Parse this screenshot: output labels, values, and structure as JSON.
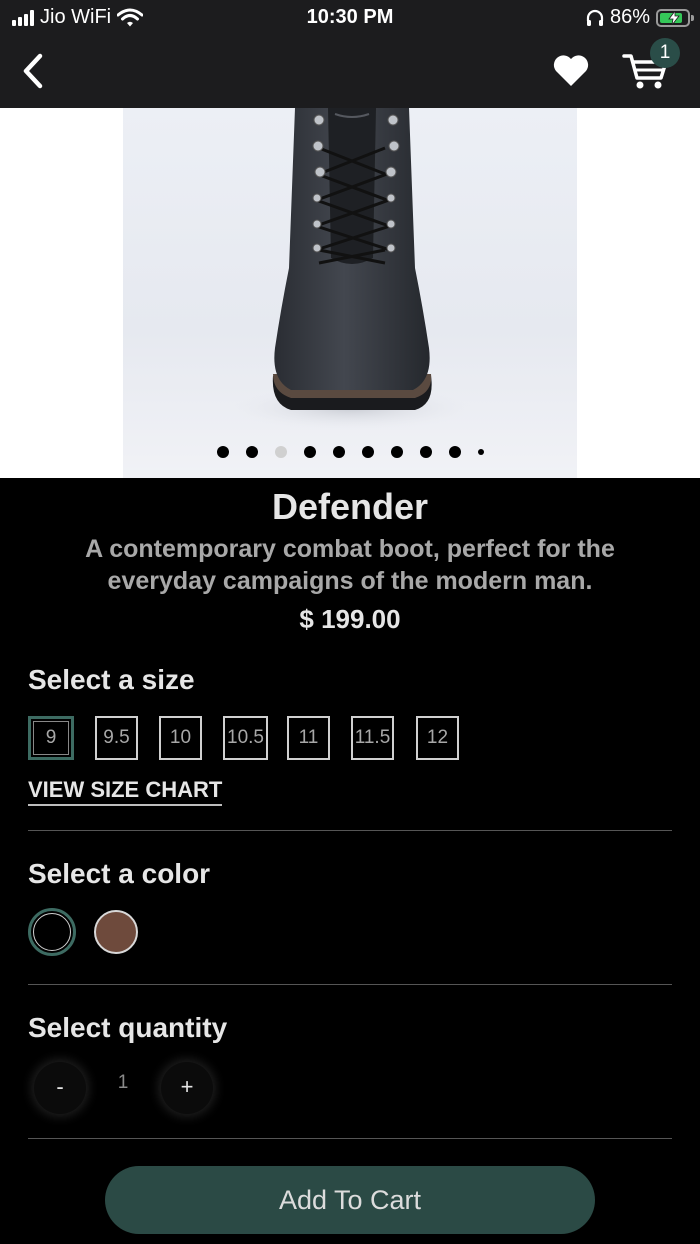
{
  "status_bar": {
    "carrier": "Jio WiFi",
    "time": "10:30 PM",
    "battery_percent": "86%",
    "battery_level": 0.86,
    "icons": [
      "signal-bars-icon",
      "wifi-icon",
      "headphones-icon",
      "battery-charging-icon"
    ]
  },
  "nav": {
    "icons": [
      "back-chevron-icon",
      "heart-icon",
      "cart-icon"
    ],
    "cart_count": "1"
  },
  "gallery": {
    "image_count": 10,
    "active_index": 2
  },
  "product": {
    "name": "Defender",
    "description_line1": "A contemporary combat boot, perfect for the",
    "description_line2": "everyday campaigns of the modern man.",
    "price": "$ 199.00"
  },
  "size_section": {
    "label": "Select a size",
    "sizes": [
      "9",
      "9.5",
      "10",
      "10.5",
      "11",
      "11.5",
      "12"
    ],
    "selected": "9",
    "size_chart_link": "VIEW SIZE CHART"
  },
  "color_section": {
    "label": "Select a color",
    "colors": [
      {
        "name": "black",
        "hex": "#000000",
        "selected": true
      },
      {
        "name": "brown",
        "hex": "#6e4a3c",
        "selected": false
      }
    ]
  },
  "quantity_section": {
    "label": "Select quantity",
    "decrement": "-",
    "value": "1",
    "increment": "+"
  },
  "cta": {
    "label": "Add To Cart",
    "color": "#2b4a45"
  },
  "colors": {
    "accent": "#3d6b62",
    "background": "#000000",
    "bar": "#1c1c1e"
  }
}
